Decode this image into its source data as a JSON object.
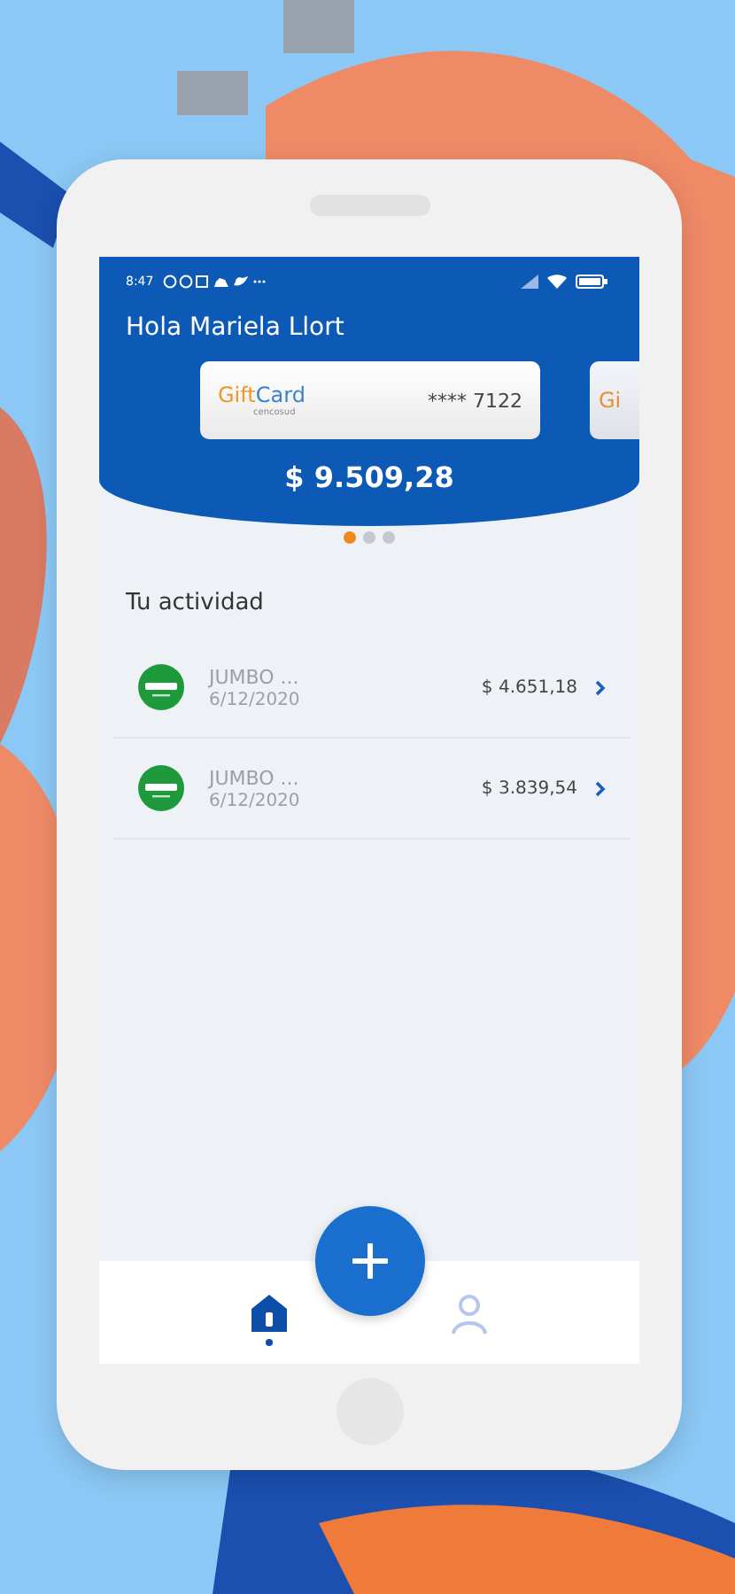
{
  "status_bar": {
    "time": "8:47"
  },
  "greeting": "Hola Mariela Llort",
  "cards": [
    {
      "logo_primary": "Gift",
      "logo_secondary": "Card",
      "issuer": "cencosud",
      "number": "**** 7122",
      "selected": true
    },
    {
      "logo_primary": "Gi",
      "selected": false
    }
  ],
  "balance": "$ 9.509,28",
  "pager": [
    {
      "selected": true
    },
    {
      "selected": false
    },
    {
      "selected": false
    }
  ],
  "section_title": "Tu actividad",
  "transactions": [
    {
      "merchant": "JUMBO ...",
      "date": "6/12/2020",
      "amount": "$ 4.651,18"
    },
    {
      "merchant": "JUMBO ...",
      "date": "6/12/2020",
      "amount": "$ 3.839,54"
    }
  ],
  "bottom_nav": [
    {
      "kind": "home",
      "selected": true
    },
    {
      "kind": "add",
      "selected": false
    },
    {
      "kind": "profile",
      "selected": false
    }
  ]
}
